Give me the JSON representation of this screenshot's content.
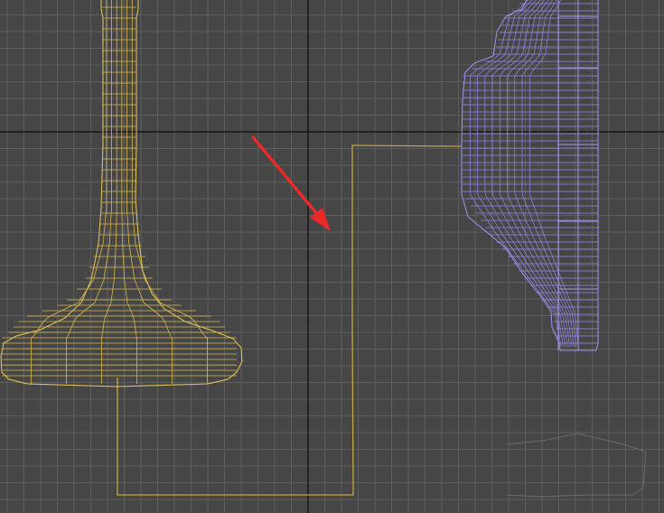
{
  "viewport": {
    "name": "3d-viewport",
    "background": "#464646",
    "grid_color": "#5e5e5e",
    "axis_color": "#0d0d0d"
  },
  "objects": [
    {
      "name": "vase-wireframe",
      "color": "#e8c95a",
      "display": "wireframe"
    },
    {
      "name": "lamp-wireframe",
      "color": "#9c98f2",
      "display": "wireframe"
    },
    {
      "name": "path-spline",
      "color": "#c2a53c",
      "display": "spline"
    }
  ],
  "annotation": {
    "name": "red-arrow",
    "color": "#ea2a2a"
  }
}
